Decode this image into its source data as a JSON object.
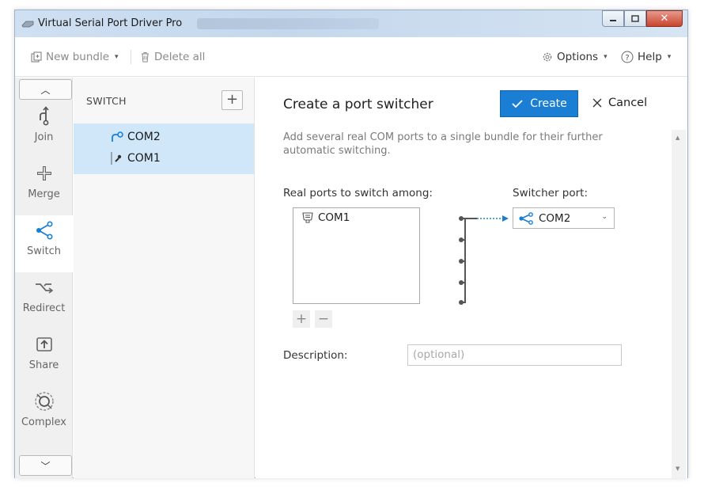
{
  "window": {
    "title": "Virtual Serial Port Driver Pro",
    "controls": [
      "minimize",
      "maximize",
      "close"
    ]
  },
  "toolbar": {
    "new_bundle": "New bundle",
    "delete_all": "Delete all",
    "options": "Options",
    "help": "Help"
  },
  "sidebar": {
    "items": [
      {
        "label": "Join",
        "icon": "join-icon"
      },
      {
        "label": "Merge",
        "icon": "merge-icon"
      },
      {
        "label": "Switch",
        "icon": "switch-icon",
        "active": true
      },
      {
        "label": "Redirect",
        "icon": "redirect-icon"
      },
      {
        "label": "Share",
        "icon": "share-icon"
      },
      {
        "label": "Complex",
        "icon": "complex-icon"
      }
    ]
  },
  "bundles": {
    "header": "SWITCH",
    "selected": {
      "switcher_port": "COM2",
      "real_ports": [
        "COM1"
      ]
    }
  },
  "form": {
    "heading": "Create a port switcher",
    "create_label": "Create",
    "cancel_label": "Cancel",
    "description": "Add several real COM ports to a single bundle for their further automatic switching.",
    "real_ports_label": "Real ports to switch among:",
    "real_ports": [
      "COM1"
    ],
    "switcher_label": "Switcher port:",
    "switcher_value": "COM2",
    "description_label": "Description:",
    "description_placeholder": "(optional)"
  },
  "colors": {
    "accent": "#1a7fd4",
    "selection": "#cfe7f8",
    "sidebar_bg": "#f0f0f0"
  }
}
